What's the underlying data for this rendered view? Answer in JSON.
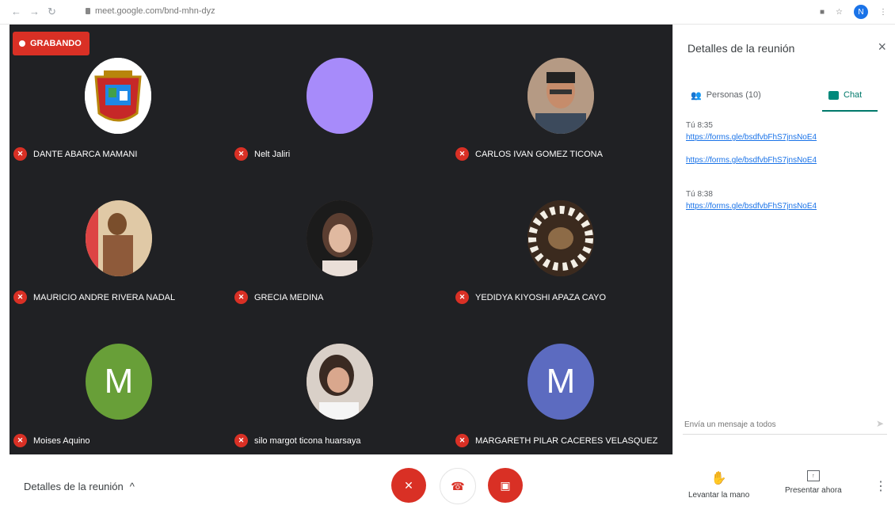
{
  "browser": {
    "url": "meet.google.com/bnd-mhn-dyz",
    "profile_initial": "N"
  },
  "recording": {
    "label": "GRABANDO"
  },
  "participants": [
    {
      "name": "DANTE ABARCA MAMANI",
      "avatar": "school-crest",
      "bg": "#ffffff"
    },
    {
      "name": "Nelt Jaliri",
      "avatar": "blank",
      "bg": "#a78bfa"
    },
    {
      "name": "CARLOS IVAN GOMEZ TICONA",
      "avatar": "photo",
      "bg": "#8a6f5a"
    },
    {
      "name": "MAURICIO ANDRE RIVERA NADAL",
      "avatar": "photo",
      "bg": "#9c7a4a"
    },
    {
      "name": "GRECIA MEDINA",
      "avatar": "photo",
      "bg": "#6b5348"
    },
    {
      "name": "YEDIDYA KIYOSHI APAZA CAYO",
      "avatar": "photo",
      "bg": "#5a4030"
    },
    {
      "name": "Moises Aquino",
      "avatar": "letter",
      "letter": "M",
      "bg": "#689f38"
    },
    {
      "name": "silo margot ticona huarsaya",
      "avatar": "photo",
      "bg": "#caa48c"
    },
    {
      "name": "MARGARETH PILAR CACERES VELASQUEZ",
      "avatar": "letter",
      "letter": "M",
      "bg": "#5c6bc0"
    }
  ],
  "panel": {
    "title": "Detalles de la reunión",
    "close": "×",
    "tabs": {
      "people": "Personas (10)",
      "chat": "Chat"
    },
    "messages": [
      {
        "sender": "Tú  8:35",
        "links": [
          "https://forms.gle/bsdfvbFhS7jnsNoE4",
          "https://forms.gle/bsdfvbFhS7jnsNoE4"
        ]
      },
      {
        "sender": "Tú  8:38",
        "links": [
          "https://forms.gle/bsdfvbFhS7jnsNoE4"
        ]
      }
    ],
    "input_placeholder": "Envía un mensaje a todos"
  },
  "bottombar": {
    "details_label": "Detalles de la reunión",
    "raise_hand": "Levantar la mano",
    "present": "Presentar ahora"
  }
}
